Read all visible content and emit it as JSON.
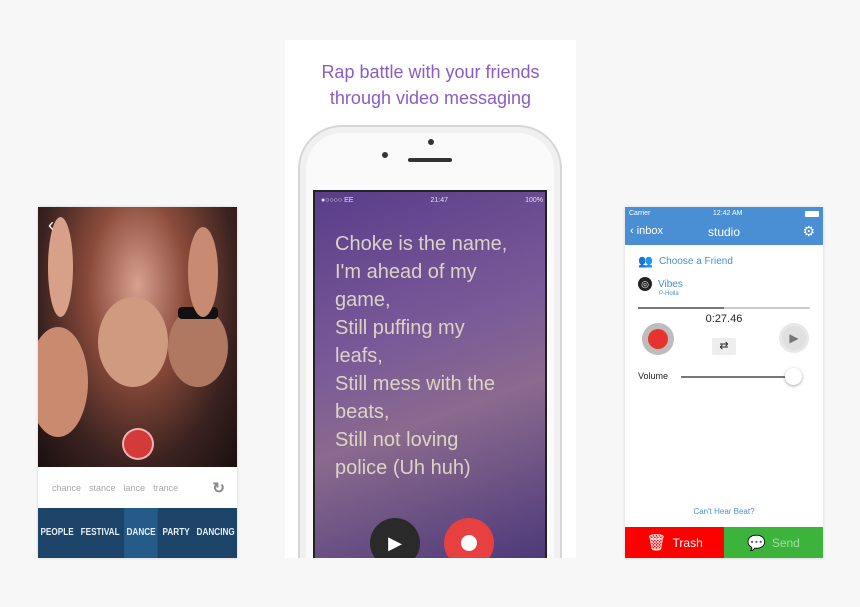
{
  "left": {
    "suggestions": [
      "chance",
      "stance",
      "lance",
      "trance"
    ],
    "tags": [
      "PEOPLE",
      "FESTIVAL",
      "DANCE",
      "PARTY",
      "DANCING"
    ],
    "selected_tag": "DANCE"
  },
  "center": {
    "headline": [
      "Rap battle with your friends",
      "through video messaging"
    ],
    "status": {
      "carrier": "●○○○○ EE",
      "time": "21:47",
      "battery": "100%"
    },
    "lyrics": [
      "Choke is the name,",
      "I'm ahead of my",
      "game,",
      "Still puffing my",
      "leafs,",
      "Still mess with the",
      "beats,",
      "Still not loving",
      "police (Uh huh)"
    ]
  },
  "right": {
    "status": {
      "carrier": "Carrier",
      "time": "12:42 AM"
    },
    "back_label": "inbox",
    "title": "studio",
    "choose_friend": "Choose a Friend",
    "beat_name": "Vibes",
    "beat_artist": "P-Holla",
    "time": "0:27.46",
    "progress": 0.5,
    "volume_label": "Volume",
    "volume": 0.95,
    "cant_hear": "Can't Hear Beat?",
    "trash": "Trash",
    "send": "Send",
    "colors": {
      "header": "#4a8fd4",
      "trash": "#ff0000",
      "send": "#3cb43c"
    }
  }
}
